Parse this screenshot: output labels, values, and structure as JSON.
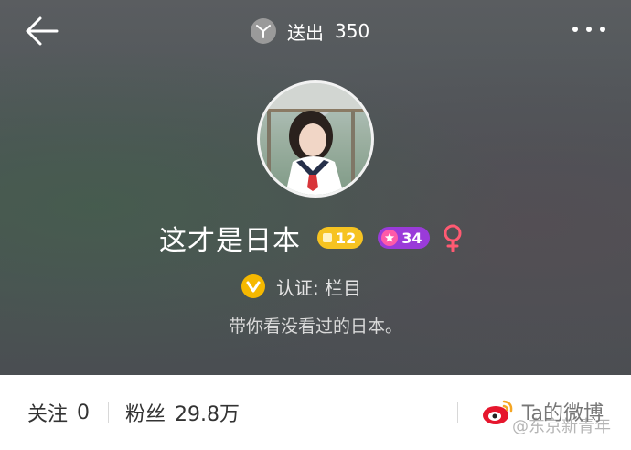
{
  "header": {
    "sent_label": "送出",
    "sent_count": "350"
  },
  "profile": {
    "name": "这才是日本",
    "level": "12",
    "star_level": "34",
    "verification": "认证: 栏目",
    "bio": "带你看没看过的日本。"
  },
  "stats": {
    "follow_label": "关注",
    "follow_count": "0",
    "fans_label": "粉丝",
    "fans_count": "29.8万",
    "weibo_link": "Ta的微博",
    "watermark": "@东京新青年"
  },
  "colors": {
    "level_badge": "#f6c321",
    "star_badge": "#9a3bd9",
    "verify_badge": "#f5b800",
    "gender_icon": "#ff5a72"
  }
}
